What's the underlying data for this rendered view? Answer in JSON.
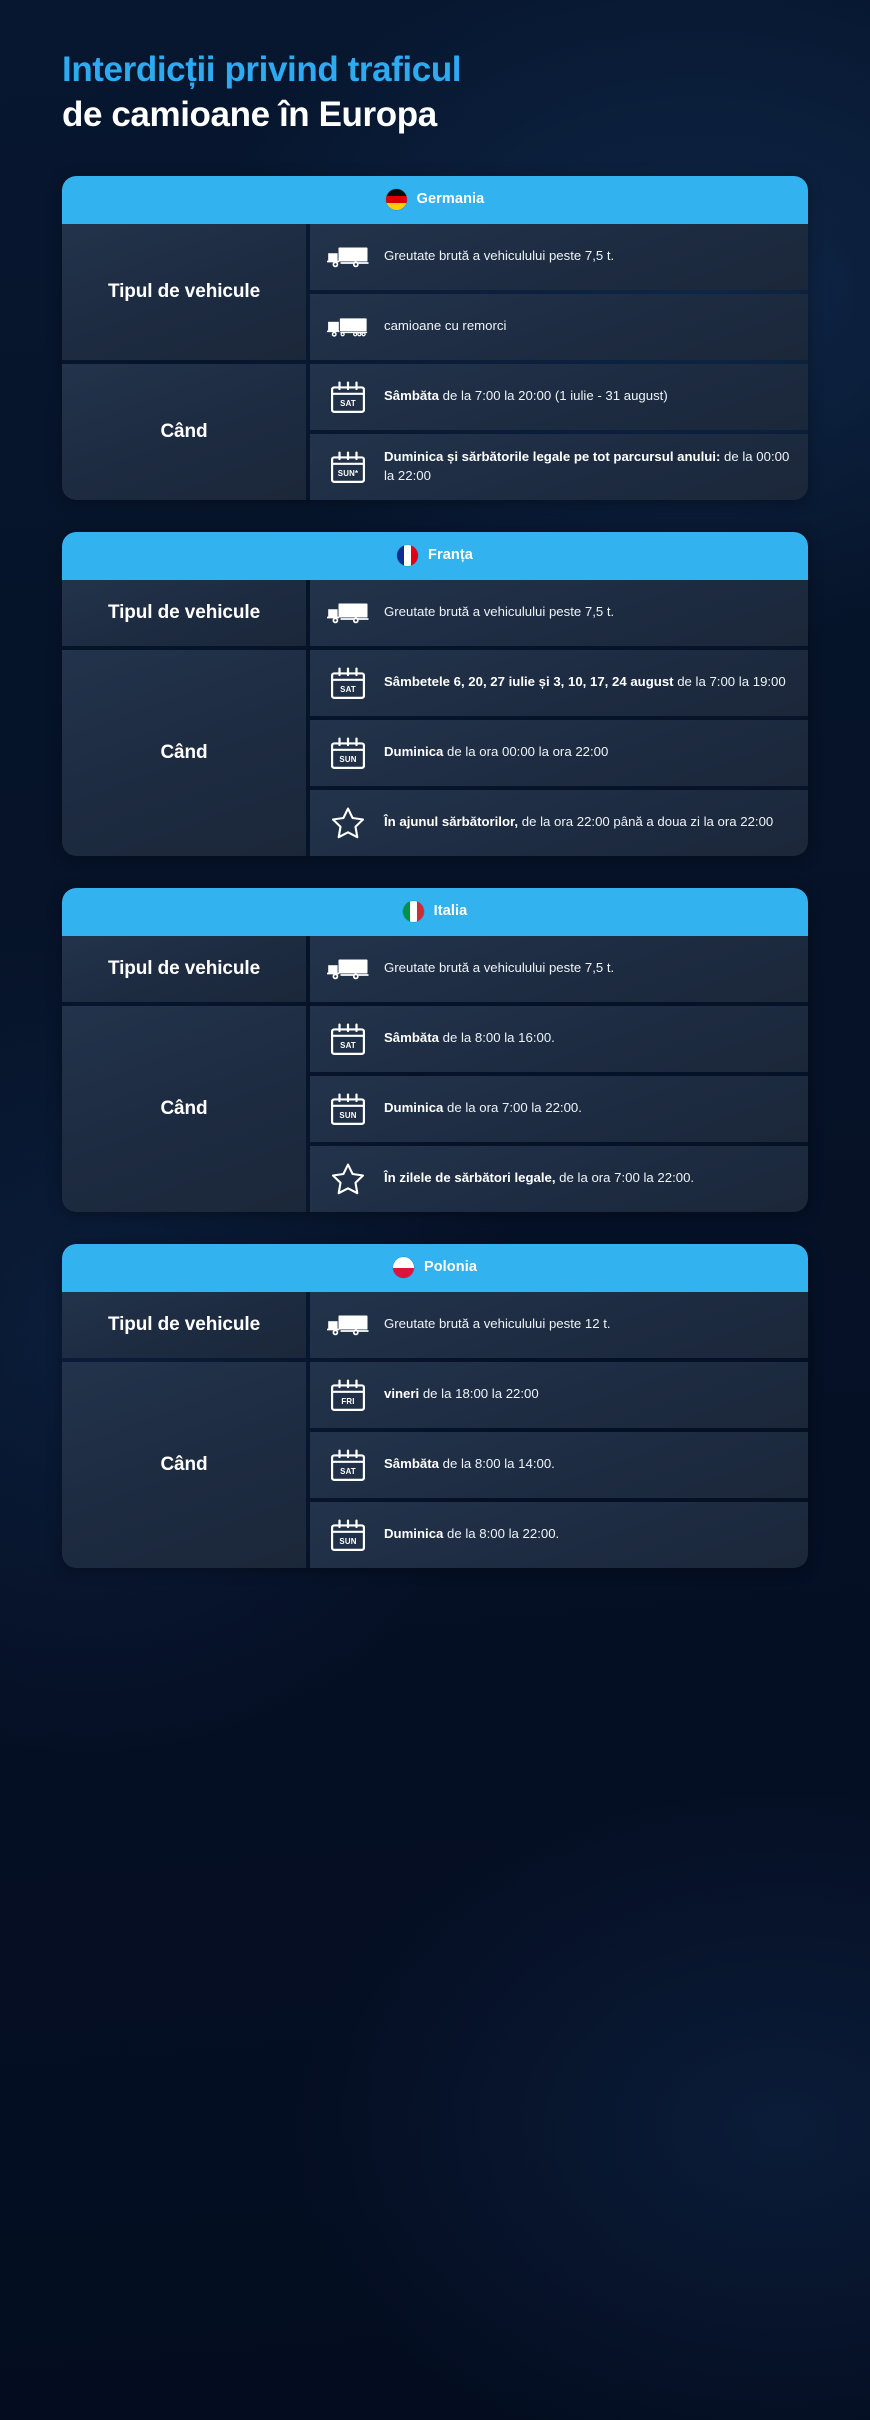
{
  "title": {
    "line1": "Interdicții privind traficul",
    "line2": "de camioane în Europa",
    "accent_color": "#2eaaf0",
    "plain_color": "#ffffff"
  },
  "theme": {
    "background": "#05112a",
    "header_blue": "#33b2f0",
    "cell_bg": "#22334b",
    "text": "#ffffff"
  },
  "labels": {
    "vehicle_type": "Tipul de vehicule",
    "when": "Când"
  },
  "countries": [
    {
      "name": "Germania",
      "flag": "flag-germany-icon",
      "flag_class": "flag-de",
      "groups": [
        {
          "label": "Tipul de vehicule",
          "rows": [
            {
              "icon": "truck-rigid-icon",
              "bold": "",
              "rest": "Greutate brută a vehiculului peste 7,5 t."
            },
            {
              "icon": "truck-trailer-icon",
              "bold": "",
              "rest": "camioane cu remorci"
            }
          ]
        },
        {
          "label": "Când",
          "rows": [
            {
              "icon": "calendar-sat-icon",
              "bold": "Sâmbăta",
              "rest": " de la 7:00 la 20:00 (1 iulie - 31 august)"
            },
            {
              "icon": "calendar-sun-star-icon",
              "bold": "Duminica și sărbătorile legale pe tot parcursul anului:",
              "rest": " de la 00:00 la 22:00"
            }
          ]
        }
      ]
    },
    {
      "name": "Franța",
      "flag": "flag-france-icon",
      "flag_class": "flag-fr",
      "groups": [
        {
          "label": "Tipul de vehicule",
          "rows": [
            {
              "icon": "truck-rigid-icon",
              "bold": "",
              "rest": "Greutate brută a vehiculului peste 7,5 t."
            }
          ]
        },
        {
          "label": "Când",
          "rows": [
            {
              "icon": "calendar-sat-icon",
              "bold": "Sâmbetele 6, 20, 27 iulie și 3, 10, 17, 24 august",
              "rest": " de la 7:00 la 19:00"
            },
            {
              "icon": "calendar-sun-icon",
              "bold": "Duminica",
              "rest": " de la ora 00:00 la ora 22:00"
            },
            {
              "icon": "star-icon",
              "bold": "În ajunul sărbătorilor,",
              "rest": " de la ora 22:00 până a doua zi la ora 22:00"
            }
          ]
        }
      ]
    },
    {
      "name": "Italia",
      "flag": "flag-italy-icon",
      "flag_class": "flag-it",
      "groups": [
        {
          "label": "Tipul de vehicule",
          "rows": [
            {
              "icon": "truck-rigid-icon",
              "bold": "",
              "rest": "Greutate brută a vehiculului peste 7,5 t."
            }
          ]
        },
        {
          "label": "Când",
          "rows": [
            {
              "icon": "calendar-sat-icon",
              "bold": "Sâmbăta",
              "rest": " de la 8:00 la 16:00."
            },
            {
              "icon": "calendar-sun-icon",
              "bold": "Duminica",
              "rest": " de la ora 7:00 la 22:00."
            },
            {
              "icon": "star-icon",
              "bold": "În zilele de sărbători legale,",
              "rest": " de la ora 7:00 la 22:00."
            }
          ]
        }
      ]
    },
    {
      "name": "Polonia",
      "flag": "flag-poland-icon",
      "flag_class": "flag-pl",
      "groups": [
        {
          "label": "Tipul de vehicule",
          "rows": [
            {
              "icon": "truck-rigid-icon",
              "bold": "",
              "rest": "Greutate brută a vehiculului peste 12 t."
            }
          ]
        },
        {
          "label": "Când",
          "rows": [
            {
              "icon": "calendar-fri-icon",
              "bold": "vineri",
              "rest": " de la 18:00 la 22:00"
            },
            {
              "icon": "calendar-sat-icon",
              "bold": "Sâmbăta",
              "rest": " de la 8:00 la 14:00."
            },
            {
              "icon": "calendar-sun-icon",
              "bold": "Duminica",
              "rest": " de la 8:00 la 22:00."
            }
          ]
        }
      ]
    }
  ],
  "icon_labels": {
    "calendar-sat-icon": "SAT",
    "calendar-sun-icon": "SUN",
    "calendar-sun-star-icon": "SUN*",
    "calendar-fri-icon": "FRI"
  }
}
